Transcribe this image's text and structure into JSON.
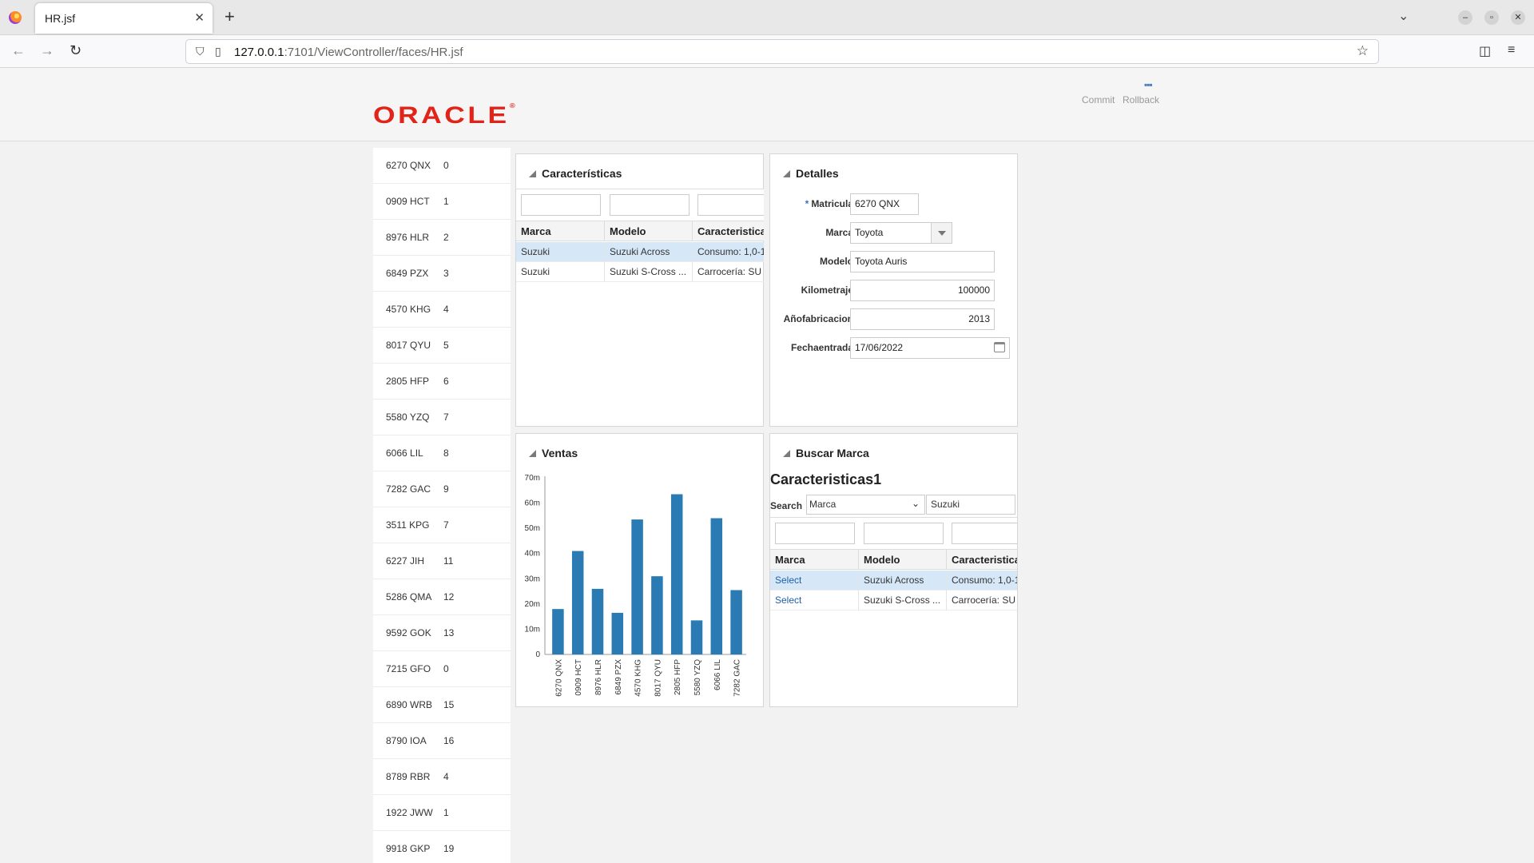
{
  "browser": {
    "tab_title": "HR.jsf",
    "url_host": "127.0.0.1",
    "url_rest": ":7101/ViewController/faces/HR.jsf"
  },
  "header": {
    "logo": "ORACLE",
    "commit": "Commit",
    "rollback": "Rollback"
  },
  "list": [
    {
      "mat": "6270 QNX",
      "num": "0"
    },
    {
      "mat": "0909 HCT",
      "num": "1"
    },
    {
      "mat": "8976 HLR",
      "num": "2"
    },
    {
      "mat": "6849 PZX",
      "num": "3"
    },
    {
      "mat": "4570 KHG",
      "num": "4"
    },
    {
      "mat": "8017 QYU",
      "num": "5"
    },
    {
      "mat": "2805 HFP",
      "num": "6"
    },
    {
      "mat": "5580 YZQ",
      "num": "7"
    },
    {
      "mat": "6066 LIL",
      "num": "8"
    },
    {
      "mat": "7282 GAC",
      "num": "9"
    },
    {
      "mat": "3511 KPG",
      "num": "7"
    },
    {
      "mat": "6227 JIH",
      "num": "11"
    },
    {
      "mat": "5286 QMA",
      "num": "12"
    },
    {
      "mat": "9592 GOK",
      "num": "13"
    },
    {
      "mat": "7215 GFO",
      "num": "0"
    },
    {
      "mat": "6890 WRB",
      "num": "15"
    },
    {
      "mat": "8790 IOA",
      "num": "16"
    },
    {
      "mat": "8789 RBR",
      "num": "4"
    },
    {
      "mat": "1922 JWW",
      "num": "1"
    },
    {
      "mat": "9918 GKP",
      "num": "19"
    }
  ],
  "caracteristicas": {
    "title": "Características",
    "headers": [
      "Marca",
      "Modelo",
      "Caracteristica"
    ],
    "rows": [
      [
        "Suzuki",
        "Suzuki Across",
        "Consumo: 1,0-1"
      ],
      [
        "Suzuki",
        "Suzuki S-Cross ...",
        "Carrocería: SU"
      ]
    ]
  },
  "detalles": {
    "title": "Detalles",
    "required_mark": "*",
    "matricula_label": "Matricula",
    "matricula": "6270 QNX",
    "marca_label": "Marca",
    "marca": "Toyota",
    "modelo_label": "Modelo",
    "modelo": "Toyota Auris",
    "km_label": "Kilometraje",
    "km": "100000",
    "anio_label": "Añofabricacion",
    "anio": "2013",
    "fecha_label": "Fechaentrada",
    "fecha": "17/06/2022"
  },
  "ventas": {
    "title": "Ventas"
  },
  "chart_data": {
    "type": "bar",
    "categories": [
      "6270 QNX",
      "0909 HCT",
      "8976 HLR",
      "6849 PZX",
      "4570 KHG",
      "8017 QYU",
      "2805 HFP",
      "5580 YZQ",
      "6066 LIL",
      "7282 GAC"
    ],
    "values": [
      18000000,
      41000000,
      26000000,
      16500000,
      53500000,
      31000000,
      63500000,
      13500000,
      54000000,
      25500000
    ],
    "ytick_labels": [
      "0",
      "10m",
      "20m",
      "30m",
      "40m",
      "50m",
      "60m",
      "70m"
    ],
    "ylim": [
      0,
      70000000
    ],
    "color": "#2a7ab4"
  },
  "buscar": {
    "title": "Buscar Marca",
    "heading": "Caracteristicas1",
    "search_label": "Search",
    "search_field": "Marca",
    "search_value": "Suzuki",
    "headers": [
      "Marca",
      "Modelo",
      "Caracteristica"
    ],
    "rows": [
      [
        "Select",
        "Suzuki Across",
        "Consumo: 1,0-1"
      ],
      [
        "Select",
        "Suzuki S-Cross ...",
        "Carrocería: SU"
      ]
    ]
  }
}
